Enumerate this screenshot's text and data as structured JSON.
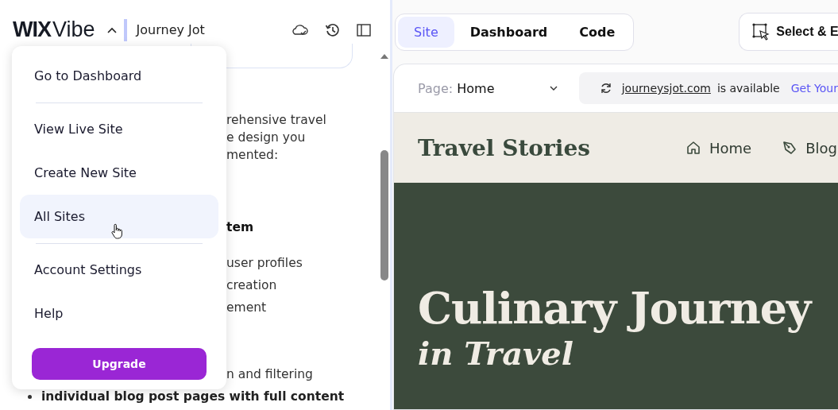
{
  "header": {
    "brand_bold": "WIX",
    "brand": "Vibe",
    "project": "Journey Jot"
  },
  "menu": {
    "items": [
      {
        "label": "Go to Dashboard",
        "hovered": false,
        "divider_after": true
      },
      {
        "label": "View Live Site",
        "hovered": false,
        "divider_after": false
      },
      {
        "label": "Create New Site",
        "hovered": false,
        "divider_after": false
      },
      {
        "label": "All Sites",
        "hovered": true,
        "divider_after": true
      },
      {
        "label": "Account Settings",
        "hovered": false,
        "divider_after": false
      },
      {
        "label": "Help",
        "hovered": false,
        "divider_after": false
      }
    ],
    "upgrade": "Upgrade"
  },
  "chat": {
    "lines": [
      {
        "text": "rehensive travel",
        "kind": "text"
      },
      {
        "text": "e design you",
        "kind": "text"
      },
      {
        "text": "mented:",
        "kind": "text"
      },
      {
        "text": "tem",
        "kind": "heading"
      },
      {
        "text": "user profiles",
        "kind": "text"
      },
      {
        "text": "creation",
        "kind": "text"
      },
      {
        "text": "ement",
        "kind": "text"
      },
      {
        "text": "n and filtering",
        "kind": "text"
      },
      {
        "text": "individual blog post pages with full content",
        "kind": "bullet"
      }
    ]
  },
  "tabs": [
    {
      "label": "Site",
      "selected": true
    },
    {
      "label": "Dashboard",
      "selected": false
    },
    {
      "label": "Code",
      "selected": false
    }
  ],
  "select_edit": "Select & E",
  "preview": {
    "page_label": "Page:",
    "page": "Home",
    "domain": "journeysjot.com",
    "available": "is available",
    "cta": "Get Your",
    "site_title": "Travel Stories",
    "nav": [
      {
        "label": "Home",
        "kind": "home"
      },
      {
        "label": "Blog",
        "kind": "blog"
      }
    ],
    "hero_title": "Culinary Journey",
    "hero_subtitle": "in Travel"
  }
}
